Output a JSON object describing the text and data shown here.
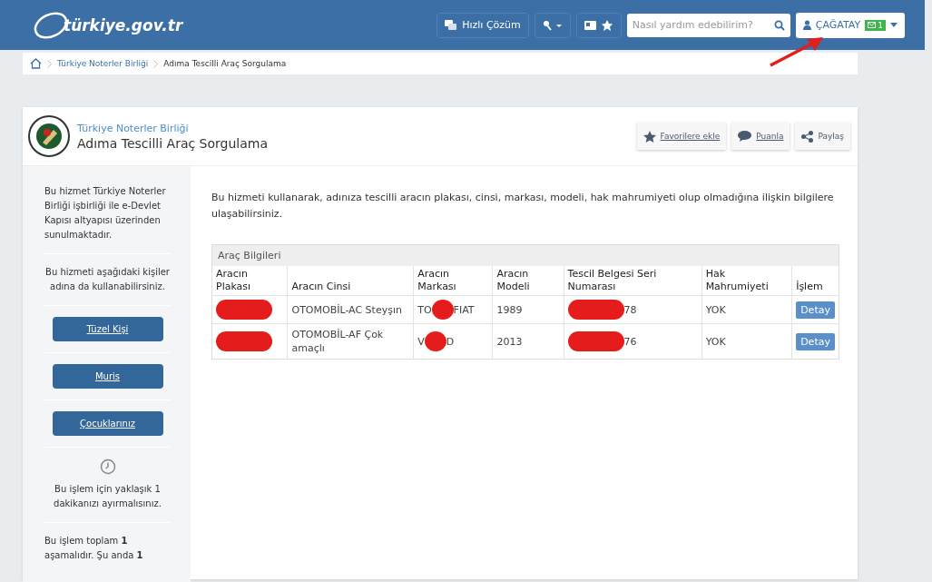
{
  "header": {
    "logo": "türkiye.gov.tr",
    "quick_solution": "Hızlı Çözüm",
    "search": {
      "placeholder": "Nasıl yardım edebilirim?"
    },
    "user": {
      "name": "ÇAĞATAY",
      "messages": "1"
    }
  },
  "breadcrumb": [
    "Türkiye Noterler Birliği",
    "Adıma Tescilli Araç Sorgulama"
  ],
  "service": {
    "institution": "Türkiye Noterler Birliği",
    "title": "Adıma Tescilli Araç Sorgulama",
    "actions": [
      {
        "kind": "favorite",
        "label": "Favorilere ekle"
      },
      {
        "kind": "rate",
        "label": "Puanla"
      },
      {
        "kind": "share",
        "label": "Paylaş"
      }
    ]
  },
  "sidebar": {
    "intro": "Bu hizmet Türkiye Noterler Birliği işbirliği ile e-Devlet Kapısı altyapısı üzerinden sunulmaktadır.",
    "on_behalf": "Bu hizmeti aşağıdaki kişiler adına da kullanabilirsiniz.",
    "buttons": [
      "Tüzel Kişi",
      "Muris",
      "Çocuklarınız"
    ],
    "duration": "Bu işlem için yaklaşık 1 dakikanızı ayırmalısınız.",
    "steps": "Bu işlem toplam **1** aşamalıdır. Şu anda **1**"
  },
  "description": "Bu hizmeti kullanarak, adınıza tescilli aracın plakası, cinsi, markası, modeli, hak mahrumiyeti olup olmadığına ilişkin bilgilere ulaşabilirsiniz.",
  "table": {
    "caption": "Araç Bilgileri",
    "columns": [
      "Aracın Plakası",
      "Aracın Cinsi",
      "Aracın Markası",
      "Aracın Modeli",
      "Tescil Belgesi Seri Numarası",
      "Hak Mahrumiyeti",
      "İşlem"
    ],
    "rows": [
      {
        "cells": [
          {
            "redacted": true
          },
          {
            "before": "OTOMOBİL-AC Steyşın",
            "redacted": false
          },
          {
            "before": "TO",
            "redacted": true,
            "after": "FIAT"
          },
          {
            "before": "1989",
            "redacted": false
          },
          {
            "redacted": true,
            "after": "78"
          },
          {
            "before": "YOK",
            "redacted": false
          }
        ],
        "action": "Detay"
      },
      {
        "cells": [
          {
            "redacted": true
          },
          {
            "before": "OTOMOBİL-AF Çok amaçlı",
            "redacted": false
          },
          {
            "before": "V",
            "redacted": true,
            "after": "D"
          },
          {
            "before": "2013",
            "redacted": false
          },
          {
            "redacted": true,
            "after": "76"
          },
          {
            "before": "YOK",
            "redacted": false
          }
        ],
        "action": "Detay"
      }
    ]
  },
  "annotation": {
    "arrow": true
  }
}
